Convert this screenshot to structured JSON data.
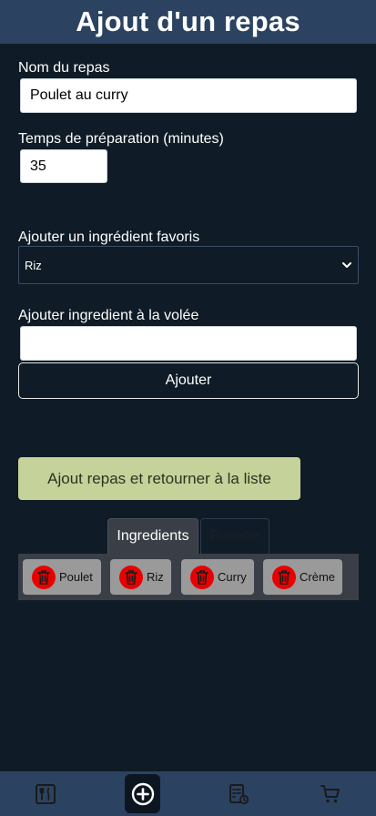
{
  "header": {
    "title": "Ajout d'un repas"
  },
  "form": {
    "meal_name": {
      "label": "Nom du repas",
      "value": "Poulet au curry"
    },
    "prep_time": {
      "label": "Temps de préparation (minutes)",
      "value": "35"
    },
    "favorite": {
      "label": "Ajouter un ingrédient favoris",
      "selected": "Riz"
    },
    "freeform": {
      "label": "Ajouter ingredient à la volée",
      "value": "",
      "button": "Ajouter"
    },
    "submit": "Ajout repas et retourner à la liste"
  },
  "tabs": [
    {
      "label": "Ingredients",
      "active": true
    },
    {
      "label": "Recette",
      "active": false
    }
  ],
  "ingredients": [
    {
      "label": "Poulet"
    },
    {
      "label": "Riz"
    },
    {
      "label": "Curry"
    },
    {
      "label": "Crème"
    }
  ],
  "bottom_nav": [
    {
      "icon": "meals-icon",
      "active": false
    },
    {
      "icon": "add-circle-icon",
      "active": true
    },
    {
      "icon": "recipe-list-icon",
      "active": false
    },
    {
      "icon": "cart-icon",
      "active": false
    }
  ],
  "colors": {
    "header_bg": "#2b4360",
    "page_bg": "#0f1b26",
    "submit_bg": "#c5d39a",
    "delete_red": "#e80000",
    "chip_bg": "#9a9a9a"
  }
}
